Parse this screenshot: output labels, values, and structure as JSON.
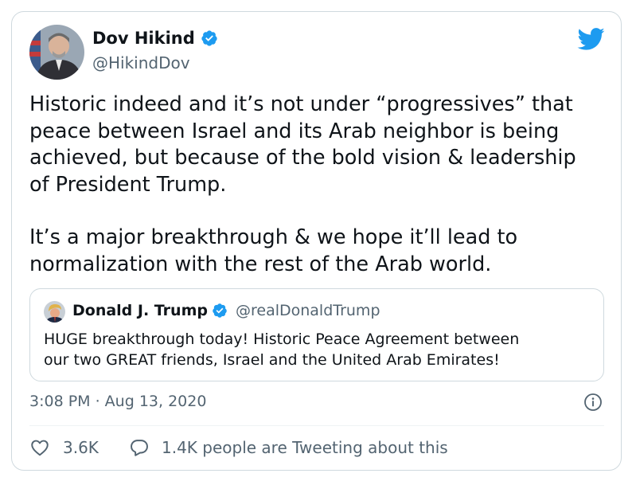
{
  "colors": {
    "text": "#0f1419",
    "muted": "#536471",
    "verified": "#1d9bf0",
    "twitter_blue": "#1d9bf0",
    "border": "#cfd9de"
  },
  "tweet": {
    "author": {
      "name": "Dov Hikind",
      "handle": "@HikindDov",
      "verified": true,
      "avatar_icon": "person-avatar"
    },
    "text_paragraphs": [
      "Historic indeed and it’s not under “progressives” that\npeace between Israel and its Arab neighbor is being\nachieved, but because of the bold vision & leadership\nof President Trump.",
      "It’s a major breakthrough & we hope it’ll lead to\nnormalization with the rest of the Arab world."
    ],
    "quoted": {
      "name": "Donald J. Trump",
      "handle": "@realDonaldTrump",
      "verified": true,
      "text": "HUGE breakthrough today! Historic Peace Agreement between\nour two GREAT friends, Israel and the United Arab Emirates!"
    },
    "timestamp": "3:08 PM · Aug 13, 2020",
    "actions": {
      "likes": "3.6K",
      "conversation": "1.4K people are Tweeting about this"
    },
    "icons": {
      "brand": "twitter-bird-icon",
      "info": "info-icon",
      "like": "heart-icon",
      "reply": "speech-bubble-icon"
    }
  }
}
